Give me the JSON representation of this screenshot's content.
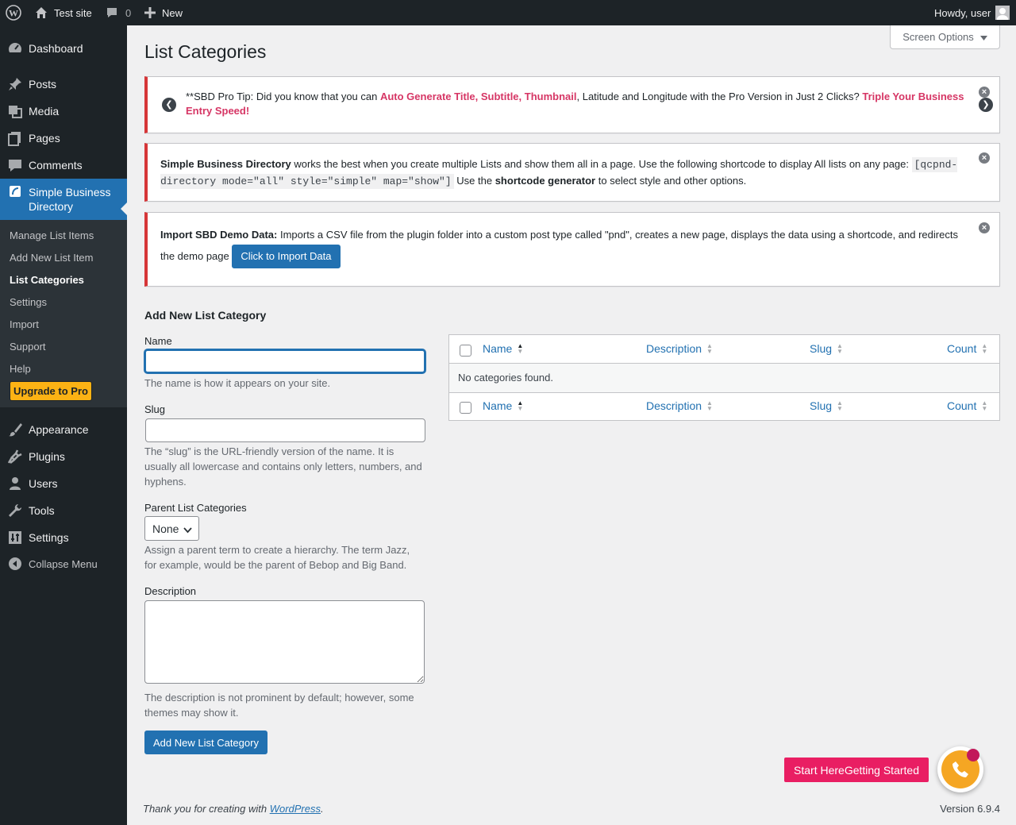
{
  "admin_bar": {
    "site_name": "Test site",
    "comments_count": "0",
    "new_label": "New",
    "howdy": "Howdy, user"
  },
  "sidebar": {
    "items": [
      {
        "label": "Dashboard"
      },
      {
        "label": "Posts"
      },
      {
        "label": "Media"
      },
      {
        "label": "Pages"
      },
      {
        "label": "Comments"
      },
      {
        "label": "Simple Business Directory"
      },
      {
        "label": "Appearance"
      },
      {
        "label": "Plugins"
      },
      {
        "label": "Users"
      },
      {
        "label": "Tools"
      },
      {
        "label": "Settings"
      },
      {
        "label": "Collapse Menu"
      }
    ],
    "submenu": [
      {
        "label": "Manage List Items"
      },
      {
        "label": "Add New List Item"
      },
      {
        "label": "List Categories"
      },
      {
        "label": "Settings"
      },
      {
        "label": "Import"
      },
      {
        "label": "Support"
      },
      {
        "label": "Help"
      }
    ],
    "upgrade_label": "Upgrade to Pro"
  },
  "screen_options": "Screen Options",
  "page_title": "List Categories",
  "notice_tip": {
    "prefix": "**SBD Pro Tip: Did you know that you can ",
    "highlight1": "Auto Generate Title, Subtitle, Thumbnail",
    "middle": ", Latitude and Longitude with the Pro Version in Just 2 Clicks? ",
    "highlight2": "Triple Your Business Entry Speed!"
  },
  "notice_shortcode": {
    "strong": "Simple Business Directory",
    "text1": " works the best when you create multiple Lists and show them all in a page. Use the following shortcode to display All lists on any page: ",
    "code": "[qcpnd-directory mode=\"all\" style=\"simple\" map=\"show\"]",
    "text2": " Use the ",
    "strong2": "shortcode generator",
    "text3": " to select style and other options."
  },
  "notice_import": {
    "strong": "Import SBD Demo Data:",
    "text": " Imports a CSV file from the plugin folder into a custom post type called \"pnd\", creates a new page, displays the data using a shortcode, and redirects the demo page ",
    "button": "Click to Import Data"
  },
  "form": {
    "heading": "Add New List Category",
    "name_label": "Name",
    "name_desc": "The name is how it appears on your site.",
    "slug_label": "Slug",
    "slug_desc": "The “slug” is the URL-friendly version of the name. It is usually all lowercase and contains only letters, numbers, and hyphens.",
    "parent_label": "Parent List Categories",
    "parent_value": "None",
    "parent_desc": "Assign a parent term to create a hierarchy. The term Jazz, for example, would be the parent of Bebop and Big Band.",
    "description_label": "Description",
    "description_desc": "The description is not prominent by default; however, some themes may show it.",
    "submit": "Add New List Category"
  },
  "table": {
    "columns": [
      "Name",
      "Description",
      "Slug",
      "Count"
    ],
    "empty": "No categories found."
  },
  "start_button": "Start HereGetting Started",
  "footer": {
    "thanks_prefix": "Thank you for creating with ",
    "thanks_link": "WordPress",
    "thanks_suffix": ".",
    "version": "Version 6.9.4"
  },
  "colors": {
    "accent": "#2271b1",
    "sidebar": "#1d2327",
    "notice_border": "#d63638",
    "highlight": "#d63665",
    "start_button": "#e91e63",
    "upgrade": "#fcb214"
  }
}
